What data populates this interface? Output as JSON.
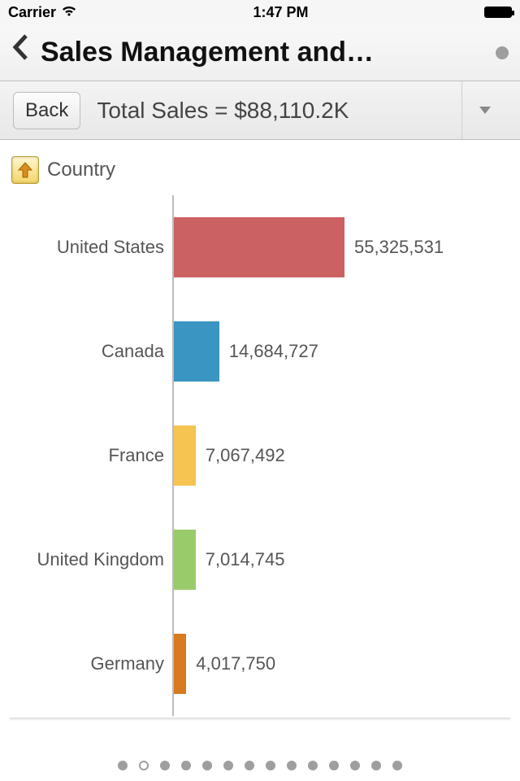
{
  "status": {
    "carrier": "Carrier",
    "time": "1:47 PM"
  },
  "nav": {
    "title": "Sales Management and…"
  },
  "subbar": {
    "back": "Back",
    "title": "Total Sales = $88,110.2K"
  },
  "dimension": "Country",
  "chart_data": {
    "type": "bar",
    "orientation": "horizontal",
    "title": "Total Sales = $88,110.2K",
    "ylabel": "Country",
    "xlabel": "",
    "categories": [
      "United States",
      "Canada",
      "France",
      "United Kingdom",
      "Germany"
    ],
    "values": [
      55325531,
      14684727,
      7067492,
      7014745,
      4017750
    ],
    "value_labels": [
      "55,325,531",
      "14,684,727",
      "7,067,492",
      "7,014,745",
      "4,017,750"
    ],
    "colors": [
      "#cc6164",
      "#3a95c2",
      "#f5c451",
      "#9acb6b",
      "#d87a1f"
    ],
    "xlim": [
      0,
      55325531
    ]
  },
  "pager": {
    "count": 14,
    "active": 1
  }
}
